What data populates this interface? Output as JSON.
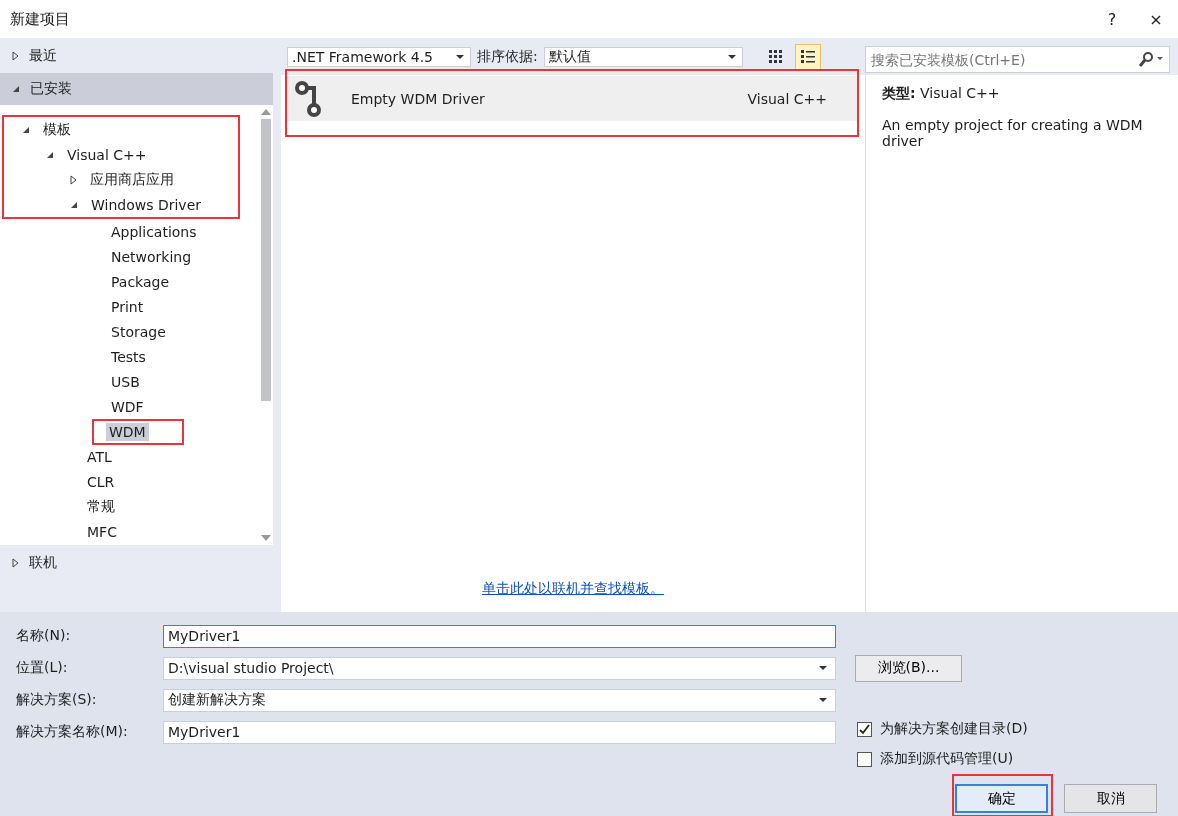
{
  "window": {
    "title": "新建项目",
    "help": "?",
    "close": "×"
  },
  "sidebar": {
    "sections": [
      {
        "label": "最近",
        "expanded": false,
        "selected": false
      },
      {
        "label": "已安装",
        "expanded": true,
        "selected": true
      }
    ],
    "tree": [
      {
        "label": "模板",
        "expanded": true,
        "selected": false,
        "outlined": true,
        "children": [
          {
            "label": "Visual C++",
            "expanded": true,
            "selected": false,
            "outlined": true,
            "children": [
              {
                "label": "应用商店应用",
                "expanded": false,
                "selected": false,
                "outlined": true
              },
              {
                "label": "Windows Driver",
                "expanded": true,
                "selected": false,
                "outlined": true,
                "children": [
                  {
                    "label": "Applications",
                    "selected": false,
                    "outlined": false
                  },
                  {
                    "label": "Networking",
                    "selected": false,
                    "outlined": false
                  },
                  {
                    "label": "Package",
                    "selected": false,
                    "outlined": false
                  },
                  {
                    "label": "Print",
                    "selected": false,
                    "outlined": false
                  },
                  {
                    "label": "Storage",
                    "selected": false,
                    "outlined": false
                  },
                  {
                    "label": "Tests",
                    "selected": false,
                    "outlined": false
                  },
                  {
                    "label": "USB",
                    "selected": false,
                    "outlined": false
                  },
                  {
                    "label": "WDF",
                    "selected": false,
                    "outlined": false
                  },
                  {
                    "label": "WDM",
                    "selected": true,
                    "outlined": true
                  }
                ]
              },
              {
                "label": "ATL",
                "selected": false,
                "outlined": false
              },
              {
                "label": "CLR",
                "selected": false,
                "outlined": false
              },
              {
                "label": "常规",
                "selected": false,
                "outlined": false
              },
              {
                "label": "MFC",
                "selected": false,
                "outlined": false
              }
            ]
          }
        ]
      }
    ],
    "online": {
      "label": "联机",
      "expanded": false
    }
  },
  "toolbar": {
    "framework": ".NET Framework 4.5",
    "sort_label": "排序依据:",
    "sort_value": "默认值",
    "views": [
      {
        "kind": "grid",
        "selected": false
      },
      {
        "kind": "list",
        "selected": true
      }
    ]
  },
  "templates": [
    {
      "name": "Empty WDM Driver",
      "language": "Visual C++",
      "selected": true,
      "outlined": true
    }
  ],
  "online_link": "单击此处以联机并查找模板。",
  "search": {
    "placeholder": "搜索已安装模板(Ctrl+E)"
  },
  "details": {
    "type": "**类型:** Visual C++",
    "description": "An empty project for creating a WDM driver"
  },
  "form": [
    {
      "label": "名称(N):",
      "value": "MyDriver1",
      "kind": "text",
      "focused": true
    },
    {
      "label": "位置(L):",
      "value": "D:\\visual studio Project\\",
      "kind": "dropdown",
      "focused": false
    },
    {
      "label": "解决方案(S):",
      "value": "创建新解决方案",
      "kind": "dropdown",
      "focused": false
    },
    {
      "label": "解决方案名称(M):",
      "value": "MyDriver1",
      "kind": "text",
      "focused": false
    }
  ],
  "browse_button": "浏览(B)...",
  "options": [
    {
      "label": "为解决方案创建目录(D)",
      "checked": true
    },
    {
      "label": "添加到源代码管理(U)",
      "checked": false
    }
  ],
  "buttons": [
    {
      "label": "确定",
      "default": true,
      "outlined": true
    },
    {
      "label": "取消",
      "default": false,
      "outlined": false
    }
  ]
}
